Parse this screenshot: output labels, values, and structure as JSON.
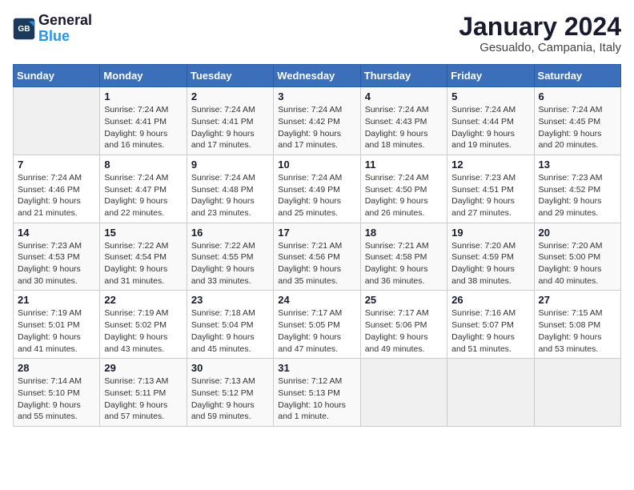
{
  "logo": {
    "line1": "General",
    "line2": "Blue"
  },
  "title": "January 2024",
  "subtitle": "Gesualdo, Campania, Italy",
  "days_header": [
    "Sunday",
    "Monday",
    "Tuesday",
    "Wednesday",
    "Thursday",
    "Friday",
    "Saturday"
  ],
  "weeks": [
    [
      {
        "day": "",
        "info": ""
      },
      {
        "day": "1",
        "info": "Sunrise: 7:24 AM\nSunset: 4:41 PM\nDaylight: 9 hours\nand 16 minutes."
      },
      {
        "day": "2",
        "info": "Sunrise: 7:24 AM\nSunset: 4:41 PM\nDaylight: 9 hours\nand 17 minutes."
      },
      {
        "day": "3",
        "info": "Sunrise: 7:24 AM\nSunset: 4:42 PM\nDaylight: 9 hours\nand 17 minutes."
      },
      {
        "day": "4",
        "info": "Sunrise: 7:24 AM\nSunset: 4:43 PM\nDaylight: 9 hours\nand 18 minutes."
      },
      {
        "day": "5",
        "info": "Sunrise: 7:24 AM\nSunset: 4:44 PM\nDaylight: 9 hours\nand 19 minutes."
      },
      {
        "day": "6",
        "info": "Sunrise: 7:24 AM\nSunset: 4:45 PM\nDaylight: 9 hours\nand 20 minutes."
      }
    ],
    [
      {
        "day": "7",
        "info": "Sunrise: 7:24 AM\nSunset: 4:46 PM\nDaylight: 9 hours\nand 21 minutes."
      },
      {
        "day": "8",
        "info": "Sunrise: 7:24 AM\nSunset: 4:47 PM\nDaylight: 9 hours\nand 22 minutes."
      },
      {
        "day": "9",
        "info": "Sunrise: 7:24 AM\nSunset: 4:48 PM\nDaylight: 9 hours\nand 23 minutes."
      },
      {
        "day": "10",
        "info": "Sunrise: 7:24 AM\nSunset: 4:49 PM\nDaylight: 9 hours\nand 25 minutes."
      },
      {
        "day": "11",
        "info": "Sunrise: 7:24 AM\nSunset: 4:50 PM\nDaylight: 9 hours\nand 26 minutes."
      },
      {
        "day": "12",
        "info": "Sunrise: 7:23 AM\nSunset: 4:51 PM\nDaylight: 9 hours\nand 27 minutes."
      },
      {
        "day": "13",
        "info": "Sunrise: 7:23 AM\nSunset: 4:52 PM\nDaylight: 9 hours\nand 29 minutes."
      }
    ],
    [
      {
        "day": "14",
        "info": "Sunrise: 7:23 AM\nSunset: 4:53 PM\nDaylight: 9 hours\nand 30 minutes."
      },
      {
        "day": "15",
        "info": "Sunrise: 7:22 AM\nSunset: 4:54 PM\nDaylight: 9 hours\nand 31 minutes."
      },
      {
        "day": "16",
        "info": "Sunrise: 7:22 AM\nSunset: 4:55 PM\nDaylight: 9 hours\nand 33 minutes."
      },
      {
        "day": "17",
        "info": "Sunrise: 7:21 AM\nSunset: 4:56 PM\nDaylight: 9 hours\nand 35 minutes."
      },
      {
        "day": "18",
        "info": "Sunrise: 7:21 AM\nSunset: 4:58 PM\nDaylight: 9 hours\nand 36 minutes."
      },
      {
        "day": "19",
        "info": "Sunrise: 7:20 AM\nSunset: 4:59 PM\nDaylight: 9 hours\nand 38 minutes."
      },
      {
        "day": "20",
        "info": "Sunrise: 7:20 AM\nSunset: 5:00 PM\nDaylight: 9 hours\nand 40 minutes."
      }
    ],
    [
      {
        "day": "21",
        "info": "Sunrise: 7:19 AM\nSunset: 5:01 PM\nDaylight: 9 hours\nand 41 minutes."
      },
      {
        "day": "22",
        "info": "Sunrise: 7:19 AM\nSunset: 5:02 PM\nDaylight: 9 hours\nand 43 minutes."
      },
      {
        "day": "23",
        "info": "Sunrise: 7:18 AM\nSunset: 5:04 PM\nDaylight: 9 hours\nand 45 minutes."
      },
      {
        "day": "24",
        "info": "Sunrise: 7:17 AM\nSunset: 5:05 PM\nDaylight: 9 hours\nand 47 minutes."
      },
      {
        "day": "25",
        "info": "Sunrise: 7:17 AM\nSunset: 5:06 PM\nDaylight: 9 hours\nand 49 minutes."
      },
      {
        "day": "26",
        "info": "Sunrise: 7:16 AM\nSunset: 5:07 PM\nDaylight: 9 hours\nand 51 minutes."
      },
      {
        "day": "27",
        "info": "Sunrise: 7:15 AM\nSunset: 5:08 PM\nDaylight: 9 hours\nand 53 minutes."
      }
    ],
    [
      {
        "day": "28",
        "info": "Sunrise: 7:14 AM\nSunset: 5:10 PM\nDaylight: 9 hours\nand 55 minutes."
      },
      {
        "day": "29",
        "info": "Sunrise: 7:13 AM\nSunset: 5:11 PM\nDaylight: 9 hours\nand 57 minutes."
      },
      {
        "day": "30",
        "info": "Sunrise: 7:13 AM\nSunset: 5:12 PM\nDaylight: 9 hours\nand 59 minutes."
      },
      {
        "day": "31",
        "info": "Sunrise: 7:12 AM\nSunset: 5:13 PM\nDaylight: 10 hours\nand 1 minute."
      },
      {
        "day": "",
        "info": ""
      },
      {
        "day": "",
        "info": ""
      },
      {
        "day": "",
        "info": ""
      }
    ]
  ]
}
